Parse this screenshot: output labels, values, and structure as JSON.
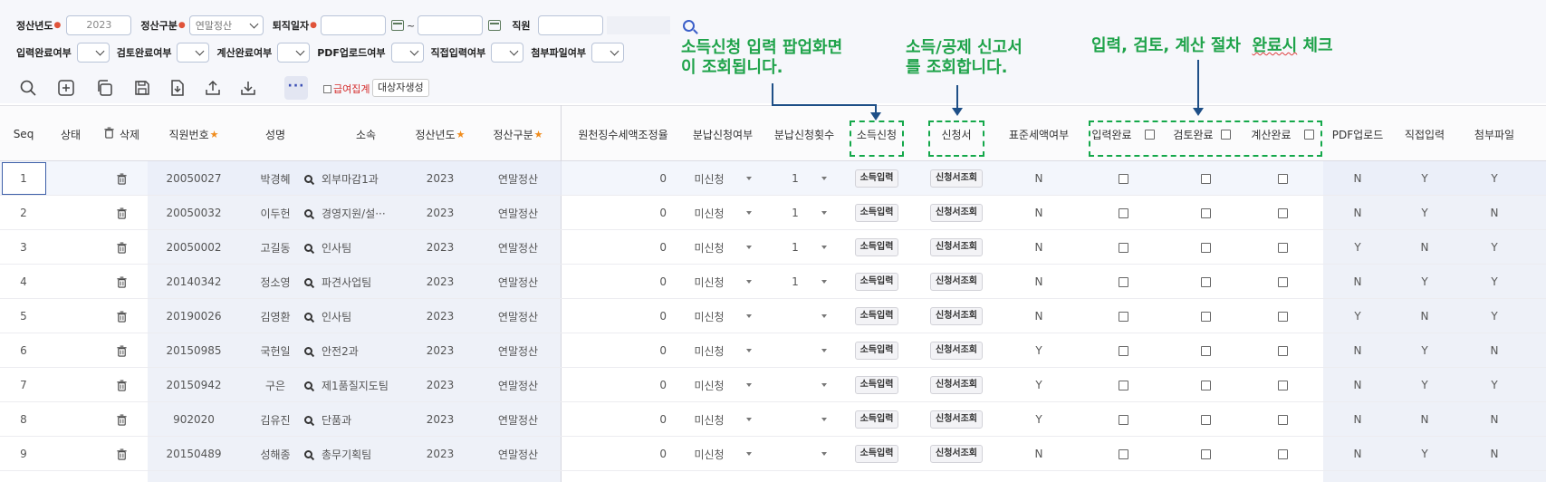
{
  "filters": {
    "year_label": "정산년도",
    "year_value": "2023",
    "type_label": "정산구분",
    "type_value": "연말정산",
    "retire_label": "퇴직일자",
    "retire_sep": "~",
    "employee_label": "직원",
    "row2": [
      {
        "label": "입력완료여부"
      },
      {
        "label": "검토완료여부"
      },
      {
        "label": "계산완료여부"
      },
      {
        "label": "PDF업로드여부"
      },
      {
        "label": "직접입력여부"
      },
      {
        "label": "첨부파일여부"
      }
    ]
  },
  "toolbar": {
    "icons": [
      "search-icon",
      "add-icon",
      "copy-icon",
      "save-icon",
      "download-file-icon",
      "upload-icon",
      "download-icon"
    ],
    "more_label": "···",
    "salary_total_label": "급여집계",
    "create_target_label": "대상자생성"
  },
  "columns": {
    "seq": "Seq",
    "status": "상태",
    "delete": "삭제",
    "emp_no": "직원번호",
    "name": "성명",
    "dept": "소속",
    "year": "정산년도",
    "type": "정산구분",
    "withholding": "원천징수세액조정율",
    "installment": "분납신청여부",
    "installment_count": "분납신청횟수",
    "income": "소득신청",
    "report": "신청서",
    "standard_deduction": "표준세액여부",
    "input_done": "입력완료",
    "review_done": "검토완료",
    "calc_done": "계산완료",
    "pdf_upload": "PDF업로드",
    "direct_input": "직접입력",
    "attachment": "첨부파일"
  },
  "buttons": {
    "income_input": "소득입력",
    "report_view": "신청서조회"
  },
  "rows": [
    {
      "seq": "1",
      "emp_no": "20050027",
      "name": "박경혜",
      "dept": "외부마감1과",
      "year": "2023",
      "type": "연말정산",
      "withholding": "0",
      "installment": "미신청",
      "count": "1",
      "std": "N",
      "pdf": "N",
      "direct": "Y",
      "attach": "Y"
    },
    {
      "seq": "2",
      "emp_no": "20050032",
      "name": "이두헌",
      "dept": "경영지원/설···",
      "year": "2023",
      "type": "연말정산",
      "withholding": "0",
      "installment": "미신청",
      "count": "1",
      "std": "N",
      "pdf": "N",
      "direct": "Y",
      "attach": "N"
    },
    {
      "seq": "3",
      "emp_no": "20050002",
      "name": "고길동",
      "dept": "인사팀",
      "year": "2023",
      "type": "연말정산",
      "withholding": "0",
      "installment": "미신청",
      "count": "1",
      "std": "N",
      "pdf": "Y",
      "direct": "N",
      "attach": "Y"
    },
    {
      "seq": "4",
      "emp_no": "20140342",
      "name": "정소영",
      "dept": "파견사업팀",
      "year": "2023",
      "type": "연말정산",
      "withholding": "0",
      "installment": "미신청",
      "count": "1",
      "std": "N",
      "pdf": "N",
      "direct": "Y",
      "attach": "Y"
    },
    {
      "seq": "5",
      "emp_no": "20190026",
      "name": "김영환",
      "dept": "인사팀",
      "year": "2023",
      "type": "연말정산",
      "withholding": "0",
      "installment": "미신청",
      "count": "",
      "std": "N",
      "pdf": "Y",
      "direct": "N",
      "attach": "Y"
    },
    {
      "seq": "6",
      "emp_no": "20150985",
      "name": "국헌일",
      "dept": "안전2과",
      "year": "2023",
      "type": "연말정산",
      "withholding": "0",
      "installment": "미신청",
      "count": "",
      "std": "Y",
      "pdf": "N",
      "direct": "Y",
      "attach": "N"
    },
    {
      "seq": "7",
      "emp_no": "20150942",
      "name": "구은",
      "dept": "제1품질지도팀",
      "year": "2023",
      "type": "연말정산",
      "withholding": "0",
      "installment": "미신청",
      "count": "",
      "std": "Y",
      "pdf": "N",
      "direct": "Y",
      "attach": "Y"
    },
    {
      "seq": "8",
      "emp_no": "902020",
      "name": "김유진",
      "dept": "단품과",
      "year": "2023",
      "type": "연말정산",
      "withholding": "0",
      "installment": "미신청",
      "count": "",
      "std": "Y",
      "pdf": "N",
      "direct": "N",
      "attach": "N"
    },
    {
      "seq": "9",
      "emp_no": "20150489",
      "name": "성해종",
      "dept": "총무기획팀",
      "year": "2023",
      "type": "연말정산",
      "withholding": "0",
      "installment": "미신청",
      "count": "",
      "std": "N",
      "pdf": "N",
      "direct": "Y",
      "attach": "N"
    }
  ],
  "annotations": {
    "note1_line1": "소득신청 입력 팝업화면",
    "note1_line2": "이 조회됩니다.",
    "note2_line1": "소득/공제 신고서",
    "note2_line2": "를 조회합니다.",
    "note3_a": "입력, 검토, 계산 절차  ",
    "note3_b": "완료시",
    "note3_c": " 체크"
  },
  "colors": {
    "accent": "#3b5fc9",
    "annotation_green": "#1fa34a",
    "arrow_blue": "#1e4f87",
    "required_star": "#f08c1d",
    "salary_total_red": "#d42a2a"
  }
}
